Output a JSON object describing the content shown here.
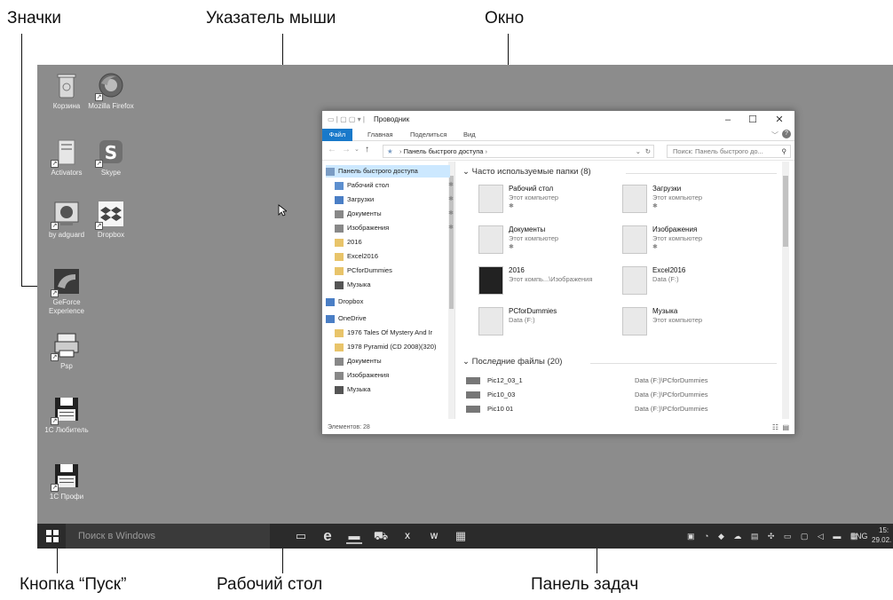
{
  "callouts": {
    "icons": "Значки",
    "pointer": "Указатель мыши",
    "window": "Окно",
    "start": "Кнопка “Пуск”",
    "desktop": "Рабочий стол",
    "taskbar": "Панель задач"
  },
  "desktop_icons": [
    {
      "label": "Корзина",
      "icon": "recycle-bin-icon"
    },
    {
      "label": "Mozilla Firefox",
      "icon": "firefox-icon"
    },
    {
      "label": "Activators",
      "icon": "folder-icon"
    },
    {
      "label": "Skype",
      "icon": "skype-icon"
    },
    {
      "label": "by adguard",
      "icon": "app-icon"
    },
    {
      "label": "Dropbox",
      "icon": "dropbox-icon"
    },
    {
      "label": "GeForce Experience",
      "icon": "geforce-icon"
    },
    {
      "label": "Psp",
      "icon": "printer-icon"
    },
    {
      "label": "1C Любитель",
      "icon": "floppy-icon"
    },
    {
      "label": "1C Профи",
      "icon": "floppy-icon"
    }
  ],
  "taskbar": {
    "search_placeholder": "Поиск в Windows",
    "lang": "ENG",
    "time": "15:",
    "date": "29.02."
  },
  "explorer": {
    "title": "Проводник",
    "tabs": [
      "Файл",
      "Главная",
      "Поделиться",
      "Вид"
    ],
    "address": "Панель быстрого доступа",
    "search_placeholder": "Поиск: Панель быстрого до...",
    "nav": [
      {
        "label": "Панель быстрого доступа",
        "pinned": false
      },
      {
        "label": "Рабочий стол",
        "pinned": true
      },
      {
        "label": "Загрузки",
        "pinned": true
      },
      {
        "label": "Документы",
        "pinned": true
      },
      {
        "label": "Изображения",
        "pinned": true
      },
      {
        "label": "2016",
        "pinned": false
      },
      {
        "label": "Excel2016",
        "pinned": false
      },
      {
        "label": "PCforDummies",
        "pinned": false
      },
      {
        "label": "Музыка",
        "pinned": false
      },
      {
        "label": "Dropbox",
        "pinned": false
      },
      {
        "label": "OneDrive",
        "pinned": false
      },
      {
        "label": "1976 Tales Of Mystery And Ir",
        "pinned": false
      },
      {
        "label": "1978 Pyramid (CD 2008)(320)",
        "pinned": false
      },
      {
        "label": "Документы",
        "pinned": false
      },
      {
        "label": "Изображения",
        "pinned": false
      },
      {
        "label": "Музыка",
        "pinned": false
      }
    ],
    "frequent_header": "Часто используемые папки (8)",
    "folders": [
      {
        "name": "Рабочий стол",
        "sub": "Этот компьютер",
        "pin": "✱"
      },
      {
        "name": "Загрузки",
        "sub": "Этот компьютер",
        "pin": "✱"
      },
      {
        "name": "Документы",
        "sub": "Этот компьютер",
        "pin": "✱"
      },
      {
        "name": "Изображения",
        "sub": "Этот компьютер",
        "pin": "✱"
      },
      {
        "name": "2016",
        "sub": "Этот компь...\\Изображения",
        "pin": ""
      },
      {
        "name": "Excel2016",
        "sub": "Data (F:)",
        "pin": ""
      },
      {
        "name": "PCforDummies",
        "sub": "Data (F:)",
        "pin": ""
      },
      {
        "name": "Музыка",
        "sub": "Этот компьютер",
        "pin": ""
      }
    ],
    "recent_header": "Последние файлы (20)",
    "recent": [
      {
        "name": "Pic12_03_1",
        "path": "Data (F:)\\PCforDummies"
      },
      {
        "name": "Pic10_03",
        "path": "Data (F:)\\PCforDummies"
      },
      {
        "name": "Pic10 01",
        "path": "Data (F:)\\PCforDummies"
      }
    ],
    "status": "Элементов: 28"
  }
}
